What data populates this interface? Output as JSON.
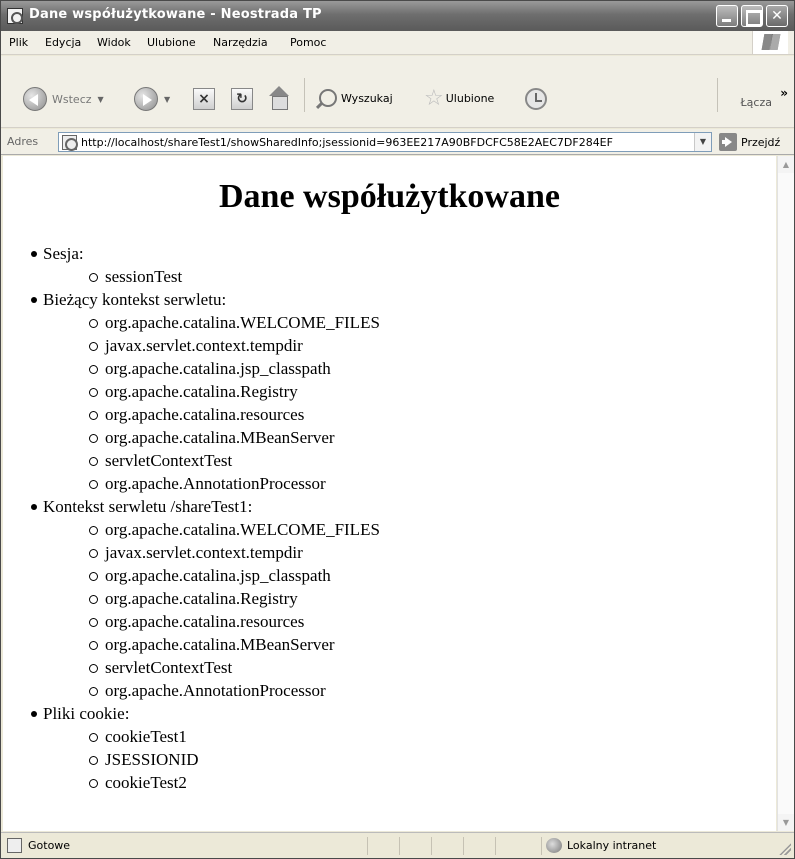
{
  "window": {
    "title": "Dane współużytkowane - Neostrada TP"
  },
  "menubar": {
    "items": [
      "Plik",
      "Edycja",
      "Widok",
      "Ulubione",
      "Narzędzia",
      "Pomoc"
    ]
  },
  "toolbar": {
    "back_label": "Wstecz",
    "search_label": "Wyszukaj",
    "favorites_label": "Ulubione",
    "links_label": "Łącza",
    "more_glyph": "»"
  },
  "addressbar": {
    "label": "Adres",
    "url": "http://localhost/shareTest1/showSharedInfo;jsessionid=963EE217A90BFDCFC58E2AEC7DF284EF",
    "go_label": "Przejdź"
  },
  "page": {
    "heading": "Dane współużytkowane",
    "sections": [
      {
        "label": "Sesja:",
        "items": [
          "sessionTest"
        ]
      },
      {
        "label": "Bieżący kontekst serwletu:",
        "items": [
          "org.apache.catalina.WELCOME_FILES",
          "javax.servlet.context.tempdir",
          "org.apache.catalina.jsp_classpath",
          "org.apache.catalina.Registry",
          "org.apache.catalina.resources",
          "org.apache.catalina.MBeanServer",
          "servletContextTest",
          "org.apache.AnnotationProcessor"
        ]
      },
      {
        "label": "Kontekst serwletu /shareTest1:",
        "items": [
          "org.apache.catalina.WELCOME_FILES",
          "javax.servlet.context.tempdir",
          "org.apache.catalina.jsp_classpath",
          "org.apache.catalina.Registry",
          "org.apache.catalina.resources",
          "org.apache.catalina.MBeanServer",
          "servletContextTest",
          "org.apache.AnnotationProcessor"
        ]
      },
      {
        "label": "Pliki cookie:",
        "items": [
          "cookieTest1",
          "JSESSIONID",
          "cookieTest2"
        ]
      }
    ]
  },
  "statusbar": {
    "status": "Gotowe",
    "zone": "Lokalny intranet"
  }
}
